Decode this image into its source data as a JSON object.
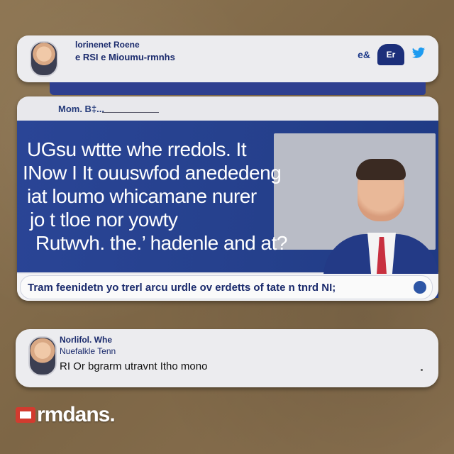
{
  "top_card": {
    "name": "lorinenet Roene",
    "handle": "e RSI e Mioumu-rmnhs",
    "tag_left": "e&",
    "tag_box": "Er",
    "twitter_icon": "bird-icon"
  },
  "main_card": {
    "header": "Mom. B‡...",
    "headline_lines": [
      "UGsu wttte whe rredols. It",
      "INow I It ouuswfod anededeng",
      "iat loumo whicamane nurer",
      "jo t tloe nor yowty",
      "Rutwvh. the.’ hadenle and at?"
    ],
    "ticker": "Tram feenidetn yo trerl arcu urdle ov erdetts of tate n tnrd NI;",
    "colors": {
      "panel_blue": "#27408f",
      "tie_red": "#c8303f"
    }
  },
  "bottom_card": {
    "name": "Norlifol. Whe",
    "subtitle": "Nuefalkle Tenn",
    "text": "RI Or bgrarm utravnt Itho mono"
  },
  "logo": {
    "text": "rmdans."
  }
}
